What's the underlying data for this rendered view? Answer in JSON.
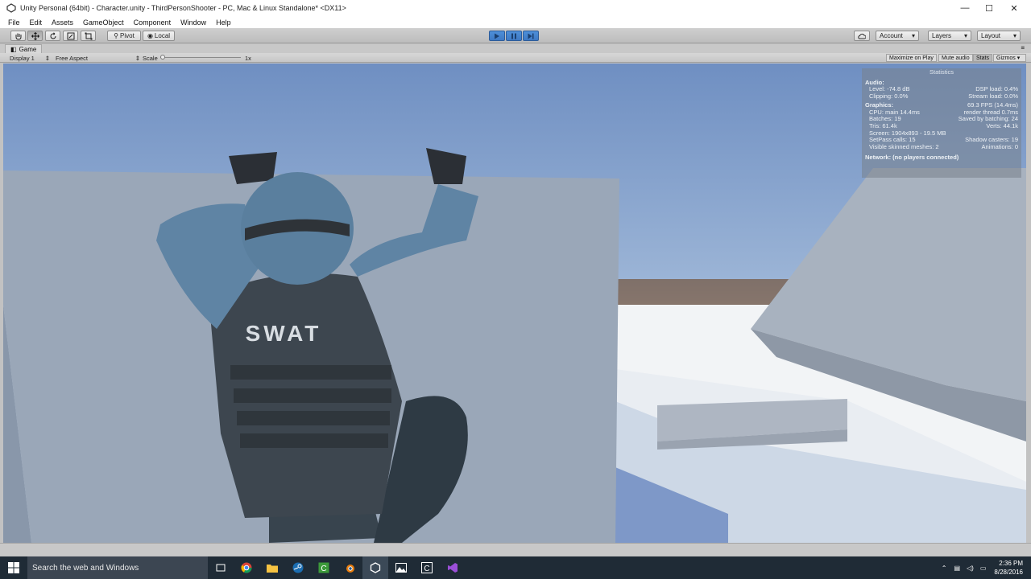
{
  "window": {
    "title": "Unity Personal (64bit) - Character.unity - ThirdPersonShooter - PC, Mac & Linux Standalone* <DX11>"
  },
  "menu": [
    "File",
    "Edit",
    "Assets",
    "GameObject",
    "Component",
    "Window",
    "Help"
  ],
  "toolbar": {
    "pivot": "Pivot",
    "local": "Local",
    "account": "Account",
    "layers": "Layers",
    "layout": "Layout"
  },
  "game_tab": {
    "label": "Game",
    "display": "Display 1",
    "aspect": "Free Aspect",
    "scale_label": "Scale",
    "scale_value": "1x",
    "maximize": "Maximize on Play",
    "mute": "Mute audio",
    "stats": "Stats",
    "gizmos": "Gizmos"
  },
  "scene": {
    "vest_text": "SWAT"
  },
  "statistics": {
    "header": "Statistics",
    "audio_label": "Audio:",
    "level": "Level: -74.8 dB",
    "dsp": "DSP load: 0.4%",
    "clipping": "Clipping: 0.0%",
    "stream": "Stream load: 0.0%",
    "graphics_label": "Graphics:",
    "fps": "69.3 FPS (14.4ms)",
    "cpu": "CPU: main 14.4ms",
    "render_thread": "render thread 0.7ms",
    "batches": "Batches: 19",
    "saved_batching": "Saved by batching: 24",
    "tris": "Tris: 61.4k",
    "verts": "Verts: 44.1k",
    "screen": "Screen: 1904x893 - 19.5 MB",
    "setpass": "SetPass calls: 15",
    "shadow": "Shadow casters: 19",
    "skinned": "Visible skinned meshes: 2",
    "animations": "Animations: 0",
    "network": "Network: (no players connected)"
  },
  "taskbar": {
    "search_placeholder": "Search the web and Windows",
    "time": "2:36 PM",
    "date": "8/28/2016"
  },
  "colors": {
    "play_active": "#3e79c4",
    "sky": "#7b9ac4",
    "taskbar": "#1f2b36"
  }
}
